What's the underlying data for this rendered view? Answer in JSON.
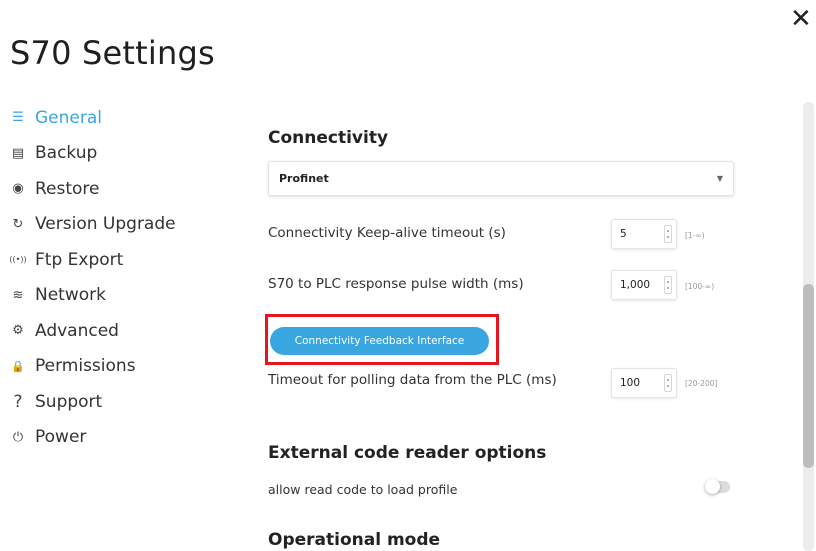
{
  "window": {
    "title": "S70 Settings",
    "close_glyph": "✕"
  },
  "sidebar": {
    "items": [
      {
        "label": "General",
        "icon": "sliders-icon",
        "glyph": "☰",
        "active": true
      },
      {
        "label": "Backup",
        "icon": "database-icon",
        "glyph": "▤",
        "active": false
      },
      {
        "label": "Restore",
        "icon": "restore-icon",
        "glyph": "◉",
        "active": false
      },
      {
        "label": "Version Upgrade",
        "icon": "refresh-icon",
        "glyph": "↻",
        "active": false
      },
      {
        "label": "Ftp Export",
        "icon": "broadcast-icon",
        "glyph": "((•))",
        "active": false
      },
      {
        "label": "Network",
        "icon": "wifi-icon",
        "glyph": "≋",
        "active": false
      },
      {
        "label": "Advanced",
        "icon": "gear-icon",
        "glyph": "⚙",
        "active": false
      },
      {
        "label": "Permissions",
        "icon": "lock-icon",
        "glyph": "🔒",
        "active": false
      },
      {
        "label": "Support",
        "icon": "question-icon",
        "glyph": "?",
        "active": false
      },
      {
        "label": "Power",
        "icon": "power-icon",
        "glyph": "⏻",
        "active": false
      }
    ]
  },
  "connectivity": {
    "section_title": "Connectivity",
    "protocol_value": "Profinet",
    "keepalive": {
      "label": "Connectivity Keep-alive timeout (s)",
      "value": "5",
      "range": "[1-∞)"
    },
    "pulse_width": {
      "label": "S70 to PLC response pulse width (ms)",
      "value": "1,000",
      "range": "[100-∞)"
    },
    "feedback_button_label": "Connectivity Feedback Interface",
    "polling_timeout": {
      "label": "Timeout for polling data from the PLC (ms)",
      "value": "100",
      "range": "[20-200]"
    }
  },
  "external_reader": {
    "section_title": "External code reader options",
    "allow_read_label": "allow read code to load profile",
    "allow_read_enabled": false
  },
  "operational": {
    "section_title": "Operational mode"
  },
  "colors": {
    "accent": "#3aa6e0",
    "highlight": "#e8141b"
  }
}
